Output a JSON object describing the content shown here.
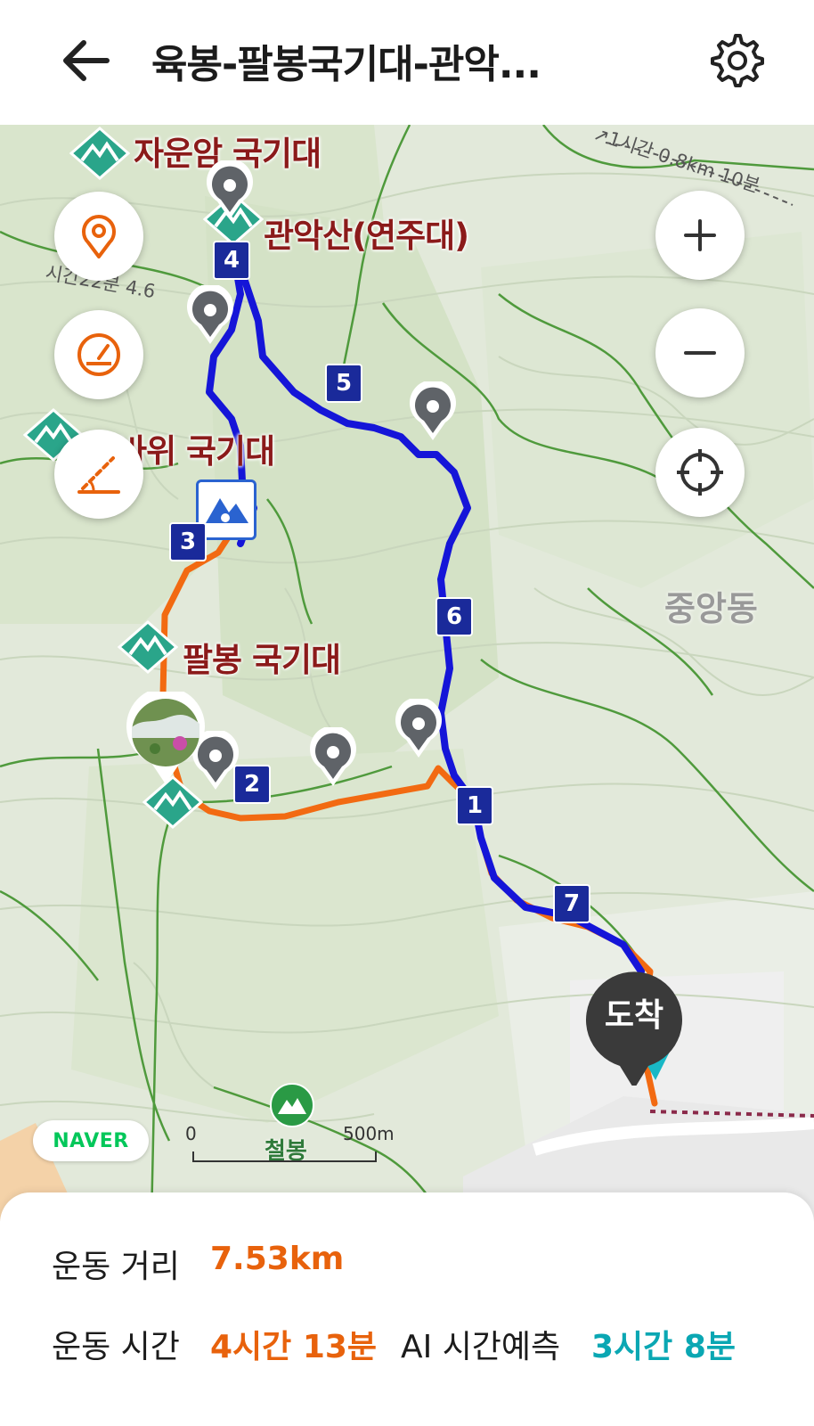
{
  "header": {
    "title": "육봉-팔봉국기대-관악..."
  },
  "map": {
    "labels": {
      "jaunam": "자운암 국기대",
      "gwanaksan": "관악산(연주대)",
      "hanbawi": "한바위 국기대",
      "palbong": "팔봉 국기대",
      "district": "중앙동",
      "cheolbong": "철봉",
      "trail_info_1": "↗1시간 0.8km 10분",
      "trail_info_2": "시간22분 4.6"
    },
    "waypoints": [
      "1",
      "2",
      "3",
      "4",
      "5",
      "6",
      "7"
    ],
    "arrival_label": "도착",
    "logo": "NAVER",
    "scale": {
      "zero": "0",
      "max": "500m"
    }
  },
  "stats": {
    "distance_label": "운동 거리",
    "distance_value": "7.53km",
    "time_label": "운동 시간",
    "time_value": "4시간 13분",
    "ai_label": "AI 시간예측",
    "ai_value": "3시간 8분"
  },
  "colors": {
    "accent_orange": "#e8620c",
    "route_blue": "#1515d8",
    "teal": "#0aa7b3",
    "label_maroon": "#8b1a1a"
  }
}
